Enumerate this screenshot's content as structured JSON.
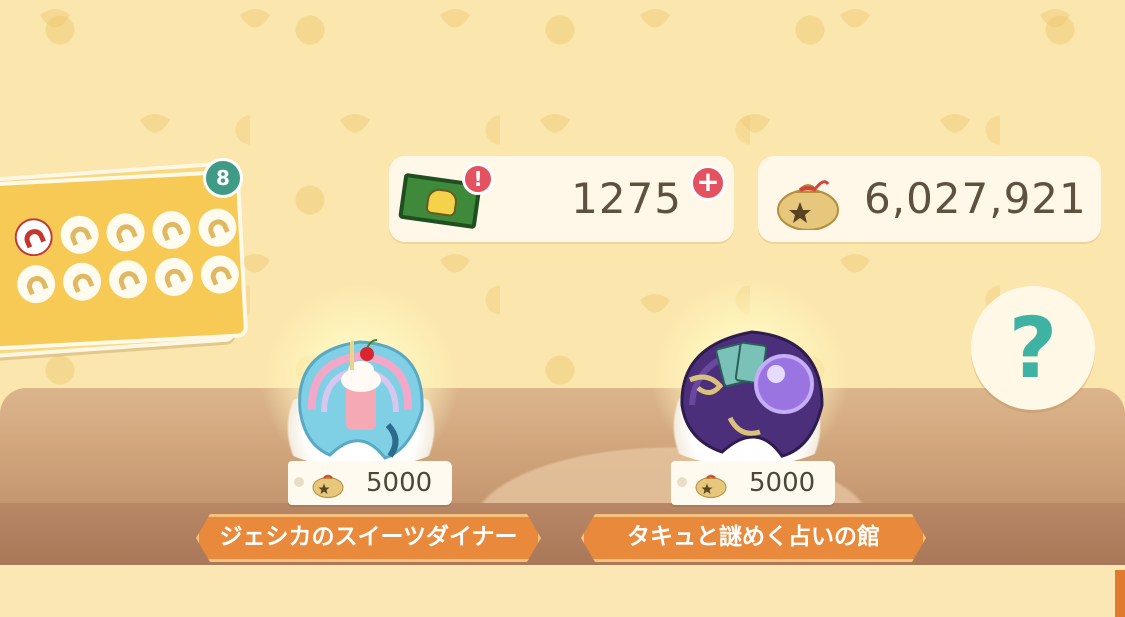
{
  "stamp_card": {
    "count_badge": "8",
    "stamps": [
      {
        "filled": true
      },
      {
        "filled": false
      },
      {
        "filled": false
      },
      {
        "filled": false
      },
      {
        "filled": false
      },
      {
        "filled": false
      },
      {
        "filled": false
      },
      {
        "filled": false
      },
      {
        "filled": false
      },
      {
        "filled": false
      }
    ]
  },
  "currency": {
    "leaf_tickets": "1275",
    "alert_mark": "!",
    "plus_mark": "+",
    "bells": "6,027,921"
  },
  "help": {
    "label": "?"
  },
  "items": [
    {
      "price": "5000",
      "name": "ジェシカのスイーツダイナー",
      "theme": "sweets-cookie-icon"
    },
    {
      "price": "5000",
      "name": "タキュと謎めく占いの館",
      "theme": "fortune-cookie-icon"
    }
  ],
  "colors": {
    "badge": "#3f9b86",
    "alert": "#e45261",
    "banner": "#e9893b",
    "help_mark": "#3fb3a3"
  }
}
